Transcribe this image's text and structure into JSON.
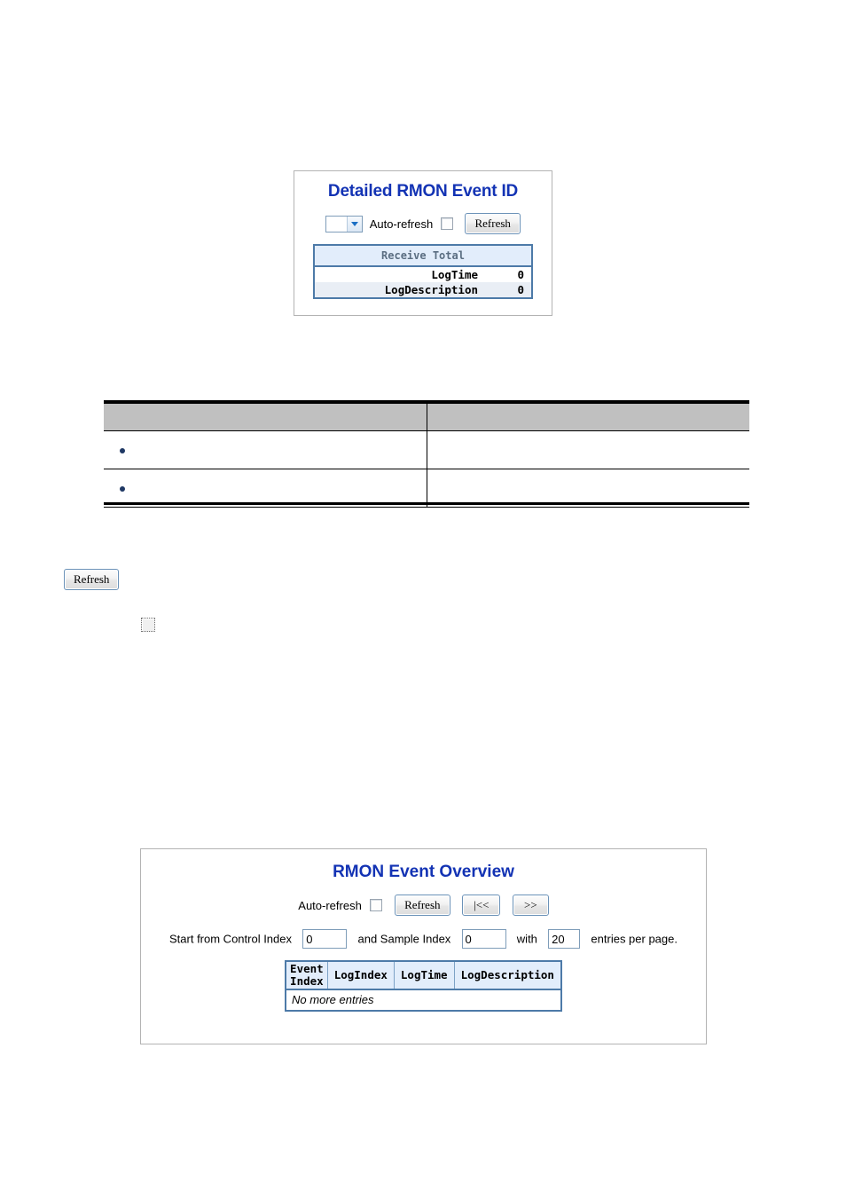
{
  "detail_panel": {
    "title": "Detailed RMON Event  ID",
    "select": {
      "name": "event-id-select",
      "value": "",
      "options": []
    },
    "auto_refresh_label": "Auto-refresh",
    "auto_refresh_checked": false,
    "refresh_label": "Refresh",
    "table": {
      "header": "Receive Total",
      "rows": [
        {
          "key": "LogTime",
          "value": "0"
        },
        {
          "key": "LogDescription",
          "value": "0"
        }
      ]
    }
  },
  "description_table": {
    "columns": [
      "",
      ""
    ],
    "rows": [
      {
        "bullet": true,
        "label": "",
        "description": ""
      },
      {
        "bullet": true,
        "label": "",
        "description": ""
      }
    ]
  },
  "standalone": {
    "refresh_label": "Refresh",
    "checkbox_checked": false
  },
  "overview_panel": {
    "title": "RMON Event Overview",
    "auto_refresh_label": "Auto-refresh",
    "auto_refresh_checked": false,
    "refresh_label": "Refresh",
    "first_page_label": "|<<",
    "next_page_label": ">>",
    "range": {
      "prefix": "Start from Control Index",
      "control_index_value": "0",
      "middle": "and Sample Index",
      "sample_index_value": "0",
      "with": "with",
      "entries_value": "20",
      "suffix": "entries per page."
    },
    "table": {
      "columns": [
        "Event Index",
        "LogIndex",
        "LogTime",
        "LogDescription"
      ],
      "col_event_line1": "Event",
      "col_event_line2": "Index",
      "empty_message": "No more entries",
      "rows": []
    }
  },
  "colors": {
    "panel_title": "#1333b4",
    "table_header_bg": "#e2edfb",
    "table_border": "#4d7aa8",
    "row_alt_bg": "#e9eef5",
    "desc_header_bg": "#c0c0c0",
    "bullet": "#1f3864"
  }
}
